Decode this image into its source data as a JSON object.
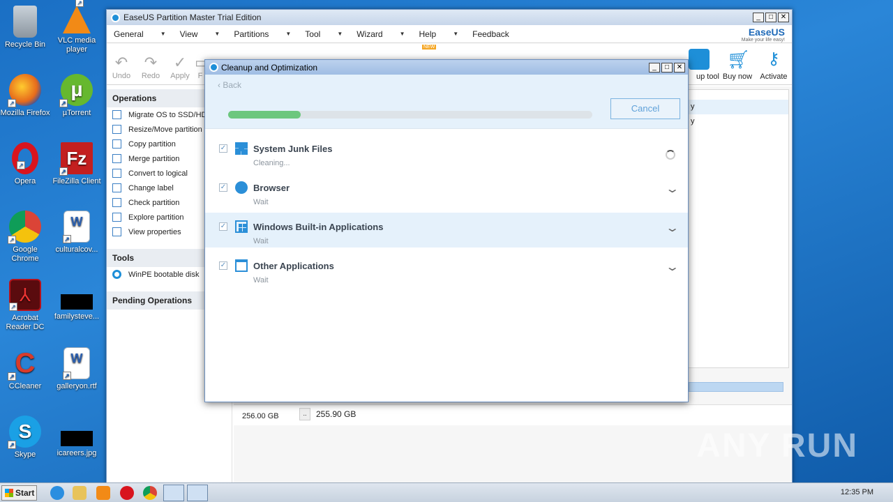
{
  "desktop": {
    "icons": [
      {
        "label": "Recycle Bin",
        "icon": "recycle-bin-icon",
        "color": "#9aa4ae"
      },
      {
        "label": "VLC media player",
        "icon": "vlc-icon",
        "color": "#f28a16"
      },
      {
        "label": "Mozilla Firefox",
        "icon": "firefox-icon",
        "color": "#e66b1c"
      },
      {
        "label": "µTorrent",
        "icon": "utorrent-icon",
        "color": "#66b82f"
      },
      {
        "label": "Opera",
        "icon": "opera-icon",
        "color": "#d8141e"
      },
      {
        "label": "FileZilla Client",
        "icon": "filezilla-icon",
        "color": "#c31f1f"
      },
      {
        "label": "Google Chrome",
        "icon": "chrome-icon",
        "color": "#3a9b4b"
      },
      {
        "label": "culturalcov...",
        "icon": "word-doc-icon",
        "color": "#2a5fb0"
      },
      {
        "label": "Acrobat Reader DC",
        "icon": "acrobat-icon",
        "color": "#b5121b"
      },
      {
        "label": "familysteve...",
        "icon": "black-file-icon",
        "color": "#000000"
      },
      {
        "label": "CCleaner",
        "icon": "ccleaner-icon",
        "color": "#d83b2b"
      },
      {
        "label": "galleryon.rtf",
        "icon": "word-doc-icon",
        "color": "#2a5fb0"
      },
      {
        "label": "Skype",
        "icon": "skype-icon",
        "color": "#1aa0e5"
      },
      {
        "label": "icareers.jpg",
        "icon": "black-file-icon",
        "color": "#000000"
      }
    ]
  },
  "main_window": {
    "title": "EaseUS Partition Master Trial Edition",
    "menu": [
      "General",
      "View",
      "Partitions",
      "Tool",
      "Wizard",
      "Help",
      "Feedback"
    ],
    "brand": {
      "name": "EaseUS",
      "tagline": "Make your life easy!"
    },
    "toolbar": [
      {
        "label": "Undo",
        "icon": "undo-icon"
      },
      {
        "label": "Redo",
        "icon": "redo-icon"
      },
      {
        "label": "Apply",
        "icon": "check-icon"
      },
      {
        "label": "F",
        "icon": "format-icon"
      }
    ],
    "toolbar_right": [
      {
        "label": "up tool",
        "icon": "backup-tool-icon",
        "color": "#1e8fd8"
      },
      {
        "label": "Buy now",
        "icon": "cart-icon",
        "color": "#1e8fd8"
      },
      {
        "label": "Activate",
        "icon": "key-icon",
        "color": "#1e8fd8"
      }
    ],
    "new_badge": "NEW",
    "operations": {
      "heading": "Operations",
      "items": [
        "Migrate OS to SSD/HD",
        "Resize/Move partition",
        "Copy partition",
        "Merge partition",
        "Convert to logical",
        "Change label",
        "Check partition",
        "Explore partition",
        "View properties"
      ]
    },
    "tools": {
      "heading": "Tools",
      "items": [
        "WinPE bootable disk"
      ]
    },
    "pending": {
      "heading": "Pending Operations"
    },
    "right_panel_rows": [
      "y",
      "y"
    ],
    "disk": {
      "size": "256.00 GB",
      "partition_size": "255.90 GB",
      "marker": ".."
    }
  },
  "dialog": {
    "title": "Cleanup and Optimization",
    "back_label": "Back",
    "cancel_label": "Cancel",
    "progress": 0.2,
    "tasks": [
      {
        "name": "System Junk Files",
        "status": "Cleaning...",
        "icon": "windows-logo-icon",
        "state": "running"
      },
      {
        "name": "Browser",
        "status": "Wait",
        "icon": "globe-icon",
        "state": "wait"
      },
      {
        "name": "Windows Built-in Applications",
        "status": "Wait",
        "icon": "windows-app-icon",
        "state": "wait"
      },
      {
        "name": "Other Applications",
        "status": "Wait",
        "icon": "window-icon",
        "state": "wait"
      }
    ]
  },
  "taskbar": {
    "start_label": "Start",
    "clock": "12:35 PM"
  },
  "watermark": "ANY RUN"
}
